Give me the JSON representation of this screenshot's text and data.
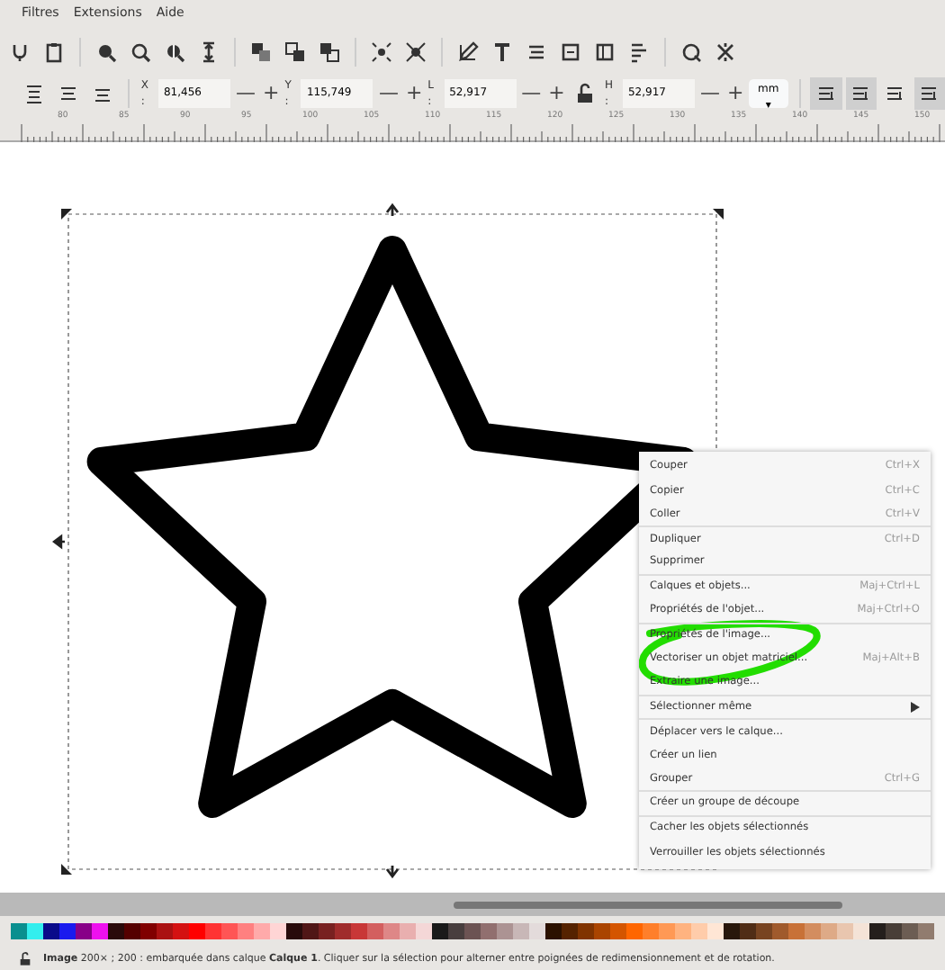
{
  "menubar": [
    "Filtres",
    "Extensions",
    "Aide"
  ],
  "fields": [
    {
      "label": "X :",
      "value": "81,456",
      "decrement": "—",
      "increment": "+"
    },
    {
      "label": "Y :",
      "value": "115,749",
      "decrement": "—",
      "increment": "+"
    },
    {
      "label": "L :",
      "value": "52,917",
      "decrement": "—",
      "increment": "+"
    },
    {
      "label": "H :",
      "value": "52,917",
      "decrement": "—",
      "increment": "+"
    }
  ],
  "unit": "mm",
  "unit_caret": "▾",
  "ruler": [
    "80",
    "85",
    "90",
    "95",
    "100",
    "105",
    "110",
    "115",
    "120",
    "125",
    "130",
    "135",
    "140",
    "145",
    "150"
  ],
  "context_menu": [
    {
      "label": "Couper",
      "shortcut": "Ctrl+X",
      "kind": "item"
    },
    {
      "label": "Copier",
      "shortcut": "Ctrl+C",
      "kind": "item"
    },
    {
      "label": "Coller",
      "shortcut": "Ctrl+V",
      "kind": "item",
      "separator_after": true
    },
    {
      "label": "Dupliquer",
      "shortcut": "Ctrl+D",
      "kind": "item"
    },
    {
      "label": "Supprimer",
      "kind": "item",
      "separator_after": true
    },
    {
      "label": "Calques et objets...",
      "shortcut": "Maj+Ctrl+L",
      "kind": "item"
    },
    {
      "label": "Propriétés de l'objet...",
      "shortcut": "Maj+Ctrl+O",
      "kind": "item",
      "separator_after": true
    },
    {
      "label": "Propriétés de l'image...",
      "kind": "item"
    },
    {
      "label": "Vectoriser un objet matriciel...",
      "shortcut": "Maj+Alt+B",
      "kind": "item"
    },
    {
      "label": "Extraire une image...",
      "kind": "item",
      "separator_after": true
    },
    {
      "label": "Sélectionner même",
      "kind": "submenu",
      "separator_after": true
    },
    {
      "label": "Déplacer vers le calque...",
      "kind": "item"
    },
    {
      "label": "Créer un lien",
      "kind": "item"
    },
    {
      "label": "Grouper",
      "shortcut": "Ctrl+G",
      "kind": "item",
      "separator_after": true
    },
    {
      "label": "Créer un groupe de découpe",
      "kind": "item",
      "separator_after": true
    },
    {
      "label": "Cacher les objets sélectionnés",
      "kind": "item"
    },
    {
      "label": "Verrouiller les objets sélectionnés",
      "kind": "item"
    }
  ],
  "palette": [
    {
      "color": "#0a8f8f"
    },
    {
      "color": "#33eeee"
    },
    {
      "color": "#0a0a8a"
    },
    {
      "color": "#1a1aee"
    },
    {
      "color": "#880088"
    },
    {
      "color": "#ee11ee"
    },
    {
      "color": "#2a0a0a"
    },
    {
      "color": "#550000"
    },
    {
      "color": "#800000"
    },
    {
      "color": "#aa1111"
    },
    {
      "color": "#d41111"
    },
    {
      "color": "#ff0000"
    },
    {
      "color": "#ff3333"
    },
    {
      "color": "#ff5555"
    },
    {
      "color": "#ff8080"
    },
    {
      "color": "#ffaaaa"
    },
    {
      "color": "#ffd5d5"
    },
    {
      "color": "#280b0b"
    },
    {
      "color": "#501616"
    },
    {
      "color": "#782121"
    },
    {
      "color": "#a02c2c"
    },
    {
      "color": "#c83737"
    },
    {
      "color": "#d35f5f"
    },
    {
      "color": "#de8787"
    },
    {
      "color": "#e9afaf"
    },
    {
      "color": "#f4d7d7"
    },
    {
      "color": "#1a1a1a"
    },
    {
      "color": "#483e3e"
    },
    {
      "color": "#6c5353"
    },
    {
      "color": "#916f6f"
    },
    {
      "color": "#ac9393"
    },
    {
      "color": "#c8b7b7"
    },
    {
      "color": "#e3dbdb"
    },
    {
      "color": "#2b1100"
    },
    {
      "color": "#552200"
    },
    {
      "color": "#803300"
    },
    {
      "color": "#aa4400"
    },
    {
      "color": "#d45500"
    },
    {
      "color": "#ff6600"
    },
    {
      "color": "#ff7f2a"
    },
    {
      "color": "#ff9955"
    },
    {
      "color": "#ffb380"
    },
    {
      "color": "#ffccaa"
    },
    {
      "color": "#ffe6d5"
    },
    {
      "color": "#28170b"
    },
    {
      "color": "#502d16"
    },
    {
      "color": "#784421"
    },
    {
      "color": "#a05a2c"
    },
    {
      "color": "#c87137"
    },
    {
      "color": "#d38d5f"
    },
    {
      "color": "#deaa87"
    },
    {
      "color": "#e9c6af"
    },
    {
      "color": "#f4e3d7"
    },
    {
      "color": "#241f1c"
    },
    {
      "color": "#483e37"
    },
    {
      "color": "#6c5d53"
    },
    {
      "color": "#917c6f"
    }
  ],
  "status": "**Image** 200× ; 200 : embarquée dans calque **Calque 1**. Cliquer sur la sélection pour alterner entre poignées de redimensionnement et de rotation."
}
